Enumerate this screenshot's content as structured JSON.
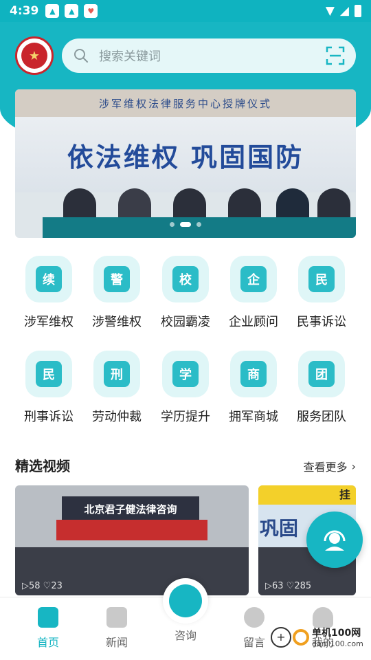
{
  "status_bar": {
    "time": "4:39"
  },
  "search": {
    "placeholder": "搜索关键词"
  },
  "banner": {
    "top_text": "涉军维权法律服务中心授牌仪式",
    "headline": "依法维权 巩固国防",
    "dots": 3,
    "active_dot": 1
  },
  "services": [
    {
      "label": "涉军维权",
      "glyph": "续",
      "icon": "military-rights-icon"
    },
    {
      "label": "涉警维权",
      "glyph": "警",
      "icon": "police-car-icon"
    },
    {
      "label": "校园霸凌",
      "glyph": "校",
      "icon": "student-icon"
    },
    {
      "label": "企业顾问",
      "glyph": "企",
      "icon": "enterprise-book-icon"
    },
    {
      "label": "民事诉讼",
      "glyph": "民",
      "icon": "civil-book-icon"
    },
    {
      "label": "刑事诉讼",
      "glyph": "民",
      "icon": "criminal-case-icon"
    },
    {
      "label": "劳动仲裁",
      "glyph": "刑",
      "icon": "labor-arbitration-icon"
    },
    {
      "label": "学历提升",
      "glyph": "学",
      "icon": "education-house-icon"
    },
    {
      "label": "拥军商城",
      "glyph": "商",
      "icon": "mall-document-icon"
    },
    {
      "label": "服务团队",
      "glyph": "团",
      "icon": "service-team-icon"
    }
  ],
  "videos_section": {
    "title": "精选视频",
    "more_label": "查看更多"
  },
  "videos": [
    {
      "sign": "北京君子健法律咨询",
      "stat": "▷58 ♡23"
    },
    {
      "top": "挂",
      "stat": "▷63 ♡285"
    }
  ],
  "tabbar": {
    "items": [
      {
        "label": "首页",
        "active": true
      },
      {
        "label": "新闻",
        "active": false
      },
      {
        "label": "咨询",
        "active": false
      },
      {
        "label": "留言",
        "active": false
      },
      {
        "label": "我的",
        "active": false
      }
    ]
  },
  "watermark": {
    "name": "单机100网",
    "url": "danji100.com"
  },
  "colors": {
    "accent": "#17b6c3",
    "tile_bg": "#dff6f7"
  }
}
